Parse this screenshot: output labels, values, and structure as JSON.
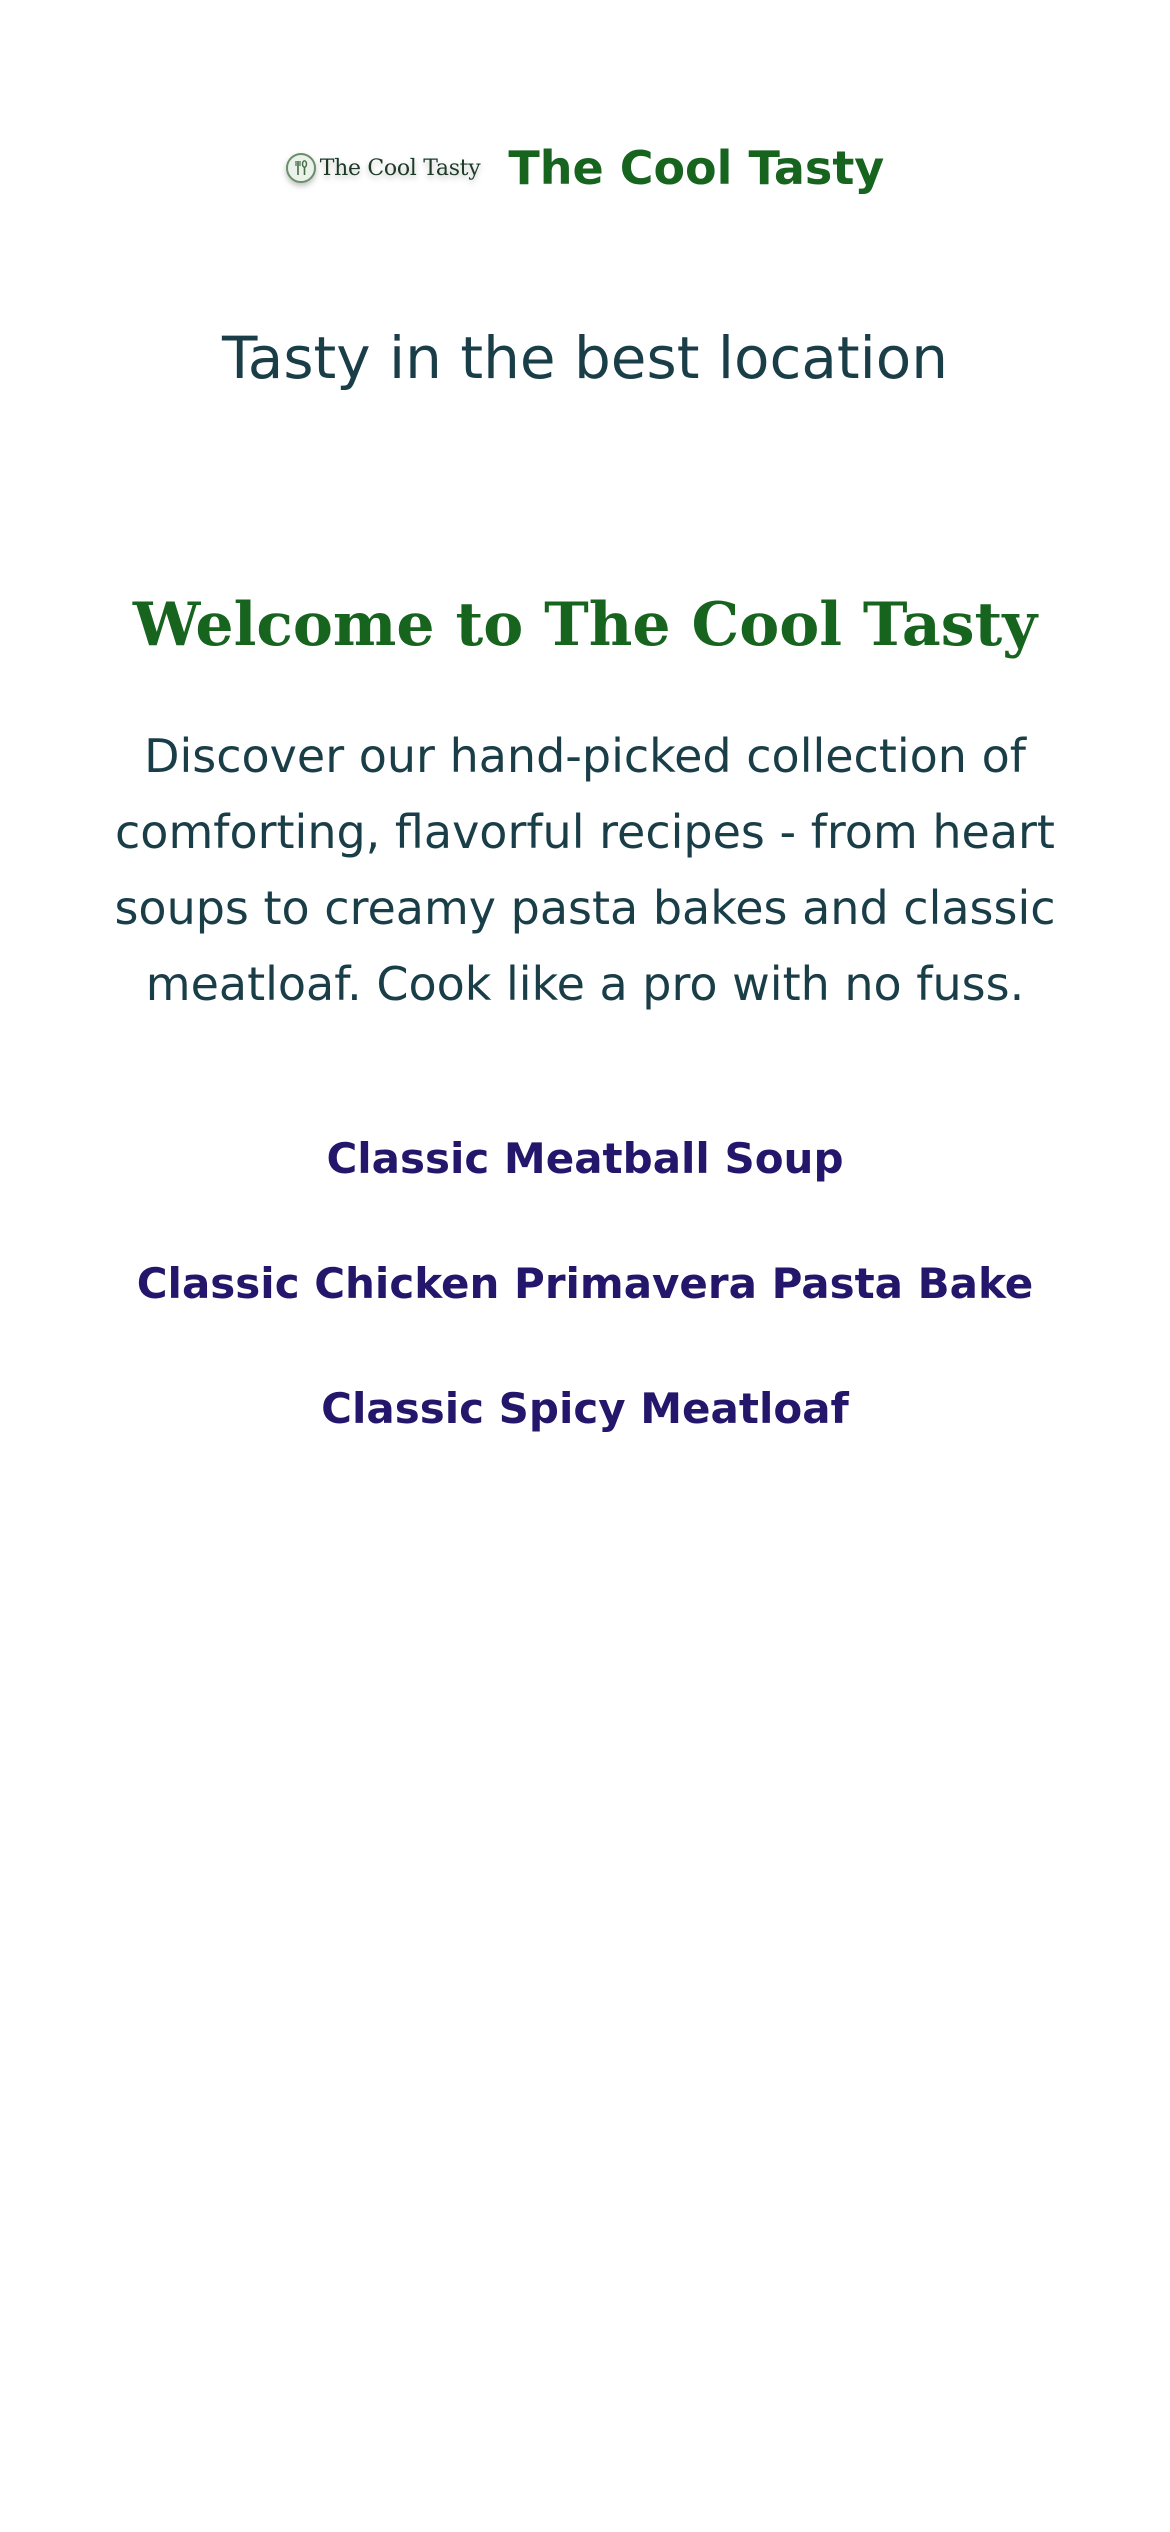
{
  "header": {
    "logo_text": "The Cool Tasty",
    "brand_name": "The Cool Tasty"
  },
  "hero": {
    "tagline": "Tasty in the best location",
    "welcome_title": "Welcome to The Cool Tasty",
    "intro": "Discover our hand-picked collection of comforting, flavorful recipes - from heart soups to creamy pasta bakes and classic meatloaf. Cook like a pro with no fuss."
  },
  "recipes": [
    {
      "label": "Classic Meatball Soup"
    },
    {
      "label": "Classic Chicken Primavera Pasta Bake"
    },
    {
      "label": "Classic Spicy Meatloaf"
    }
  ],
  "colors": {
    "brand_green": "#17641f",
    "text_teal": "#1a3e48",
    "link_indigo": "#24166b",
    "background": "#ffffff"
  },
  "icons": {
    "logo_mark": "fork-and-spoon-icon"
  }
}
